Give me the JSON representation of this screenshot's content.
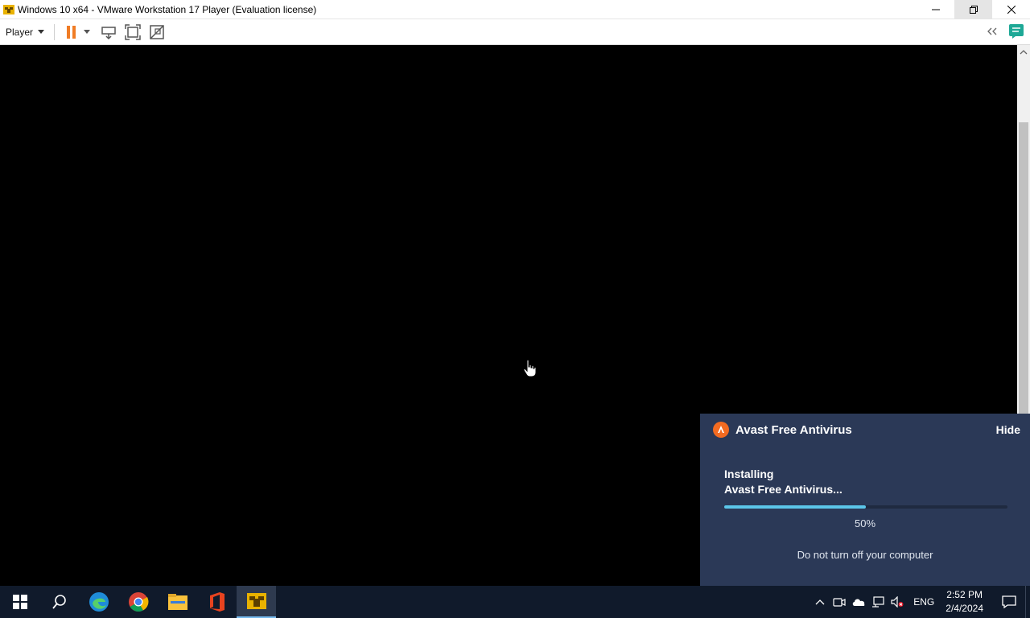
{
  "window": {
    "title": "Windows 10 x64 - VMware Workstation 17 Player (Evaluation license)",
    "controls": [
      "minimize",
      "restore",
      "close"
    ]
  },
  "toolbar": {
    "player_label": "Player",
    "icons": [
      "pause-icon",
      "dropdown-arrow-icon",
      "send-ctrl-alt-del-icon",
      "fit-guest-icon",
      "unity-icon",
      "collapse-icon",
      "message-log-icon"
    ]
  },
  "notification": {
    "app_name": "Avast Free Antivirus",
    "hide_label": "Hide",
    "status_line1": "Installing",
    "status_line2": "Avast Free Antivirus...",
    "progress": 0.5,
    "progress_label": "50%",
    "note": "Do not turn off your computer",
    "colors": {
      "background": "#2b3957",
      "progress": "#5bc6e9",
      "logo": "#f36b21"
    }
  },
  "taskbar": {
    "apps": [
      "start-icon",
      "search-icon",
      "edge-icon",
      "chrome-icon",
      "file-explorer-icon",
      "office-icon",
      "vmware-icon"
    ],
    "tray": {
      "language": "ENG",
      "time": "2:52 PM",
      "date": "2/4/2024"
    }
  }
}
